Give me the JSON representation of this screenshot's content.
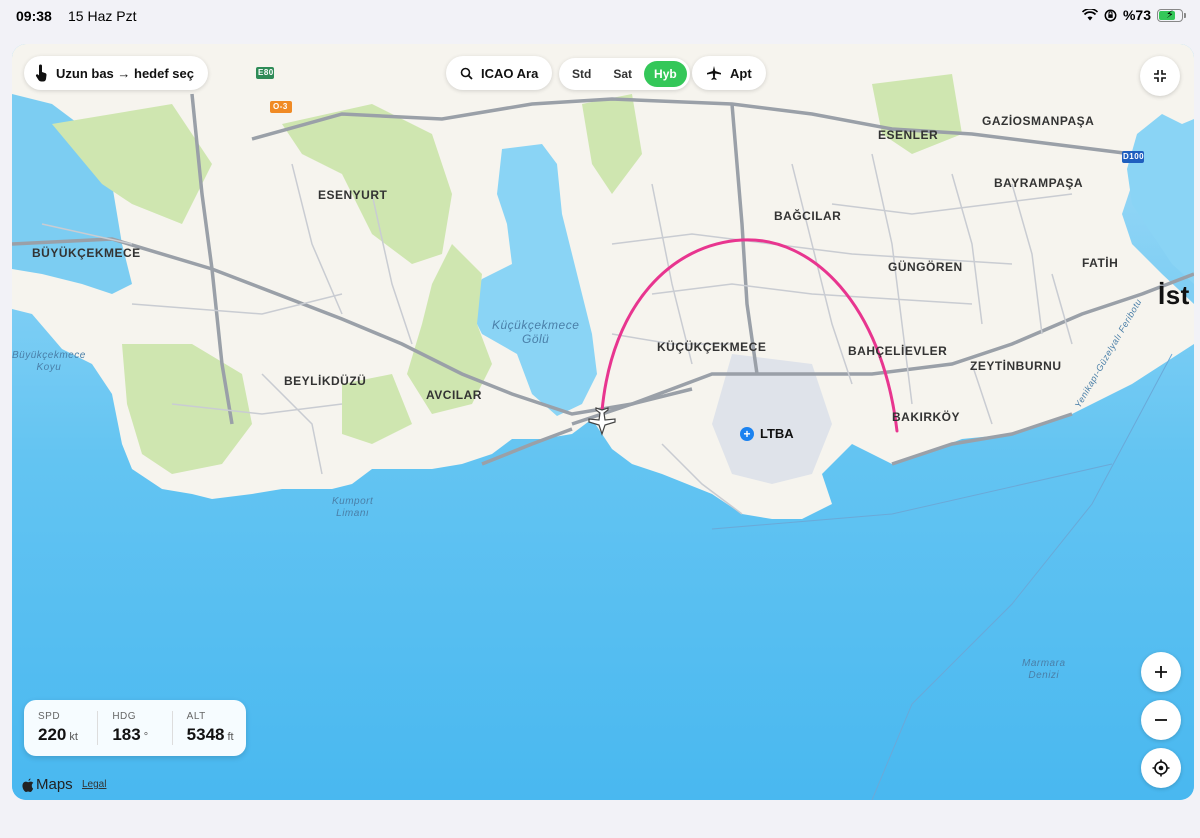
{
  "status": {
    "time": "09:38",
    "date": "15 Haz Pzt",
    "battery": "%73"
  },
  "toolbar": {
    "hint_label": "Uzun bas → hedef seç",
    "search_label": "ICAO Ara",
    "map_modes": [
      "Std",
      "Sat",
      "Hyb"
    ],
    "active_mode": "Hyb",
    "airport_label": "Apt"
  },
  "hud": {
    "speed": {
      "label": "SPD",
      "value": "220",
      "unit": "kt"
    },
    "heading": {
      "label": "HDG",
      "value": "183",
      "unit": "°"
    },
    "altitude": {
      "label": "ALT",
      "value": "5348",
      "unit": "ft"
    }
  },
  "map": {
    "brand": "Maps",
    "legal": "Legal",
    "airport": "LTBA",
    "route_color": "#e8358f",
    "places": [
      "ESENLER",
      "GAZİOSMANPAŞA",
      "ESENYURT",
      "BAYRAMPAŞA",
      "BAĞCILAR",
      "BÜYÜKÇEKMECE",
      "GÜNGÖREN",
      "FATİH",
      "İst",
      "KÜÇÜKÇEKMECE",
      "BAHÇELİEVLER",
      "ZEYTİNBURNU",
      "BEYLİKDÜZÜ",
      "AVCILAR",
      "BAKIRKÖY"
    ],
    "water": {
      "lake": "Küçükçekmece\nGölü",
      "buyuk": "Büyükçekmece\nKoyu",
      "port": "Kumport\nLimanı",
      "sea": "Marmara\nDenizi",
      "ferry": "Yenikapı-Güzelyalı Feribotu"
    },
    "shields": {
      "e80": "E80",
      "o3": "O-3",
      "d100": "D100"
    }
  }
}
